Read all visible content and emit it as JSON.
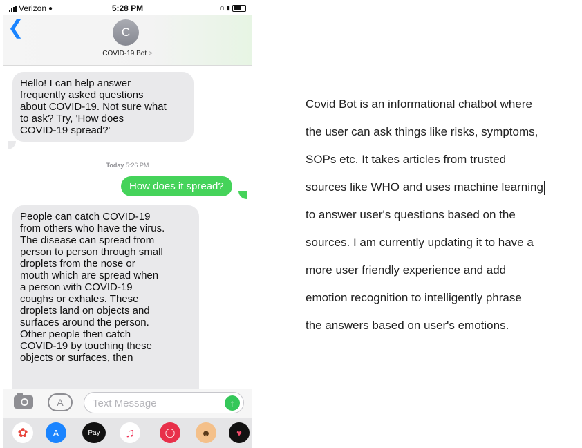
{
  "status_bar": {
    "carrier": "Verizon",
    "time": "5:28 PM"
  },
  "header": {
    "avatar_initial": "C",
    "contact_name": "COVID-19 Bot",
    "contact_chevron": ">"
  },
  "messages": {
    "m1": [
      "Hello! I can help answer",
      "frequently asked questions",
      "about COVID-19. Not sure what",
      "to ask? Try, 'How does",
      "COVID-19 spread?'"
    ],
    "timestamp_day": "Today",
    "timestamp_time": "5:26 PM",
    "m2": "How does it spread?",
    "m3": [
      "People can catch COVID-19",
      "from others who have the virus.",
      "The disease can spread from",
      "person to person through small",
      "droplets from the nose or",
      "mouth which are spread when",
      "a person with COVID-19",
      "coughs or exhales. These",
      "droplets land on objects and",
      "surfaces around the person.",
      "Other people then catch",
      "COVID-19 by touching these",
      "objects or surfaces, then"
    ]
  },
  "input": {
    "placeholder": "Text Message"
  },
  "drawer": {
    "apple_pay_label": "Pay"
  },
  "description": {
    "lines": [
      "Covid Bot is an informational chatbot where",
      "the user can ask things like risks, symptoms,",
      "SOPs etc. It takes articles from trusted",
      "sources like WHO and uses machine learning",
      "to answer user's questions based on the",
      "sources. I am currently updating it to have a",
      "more user friendly experience and add",
      "emotion recognition to intelligently phrase",
      "the answers based on user's emotions."
    ]
  },
  "colors": {
    "ios_blue": "#1a84ff",
    "sent_bubble": "#45d35a",
    "received_bubble": "#e9e9eb"
  }
}
